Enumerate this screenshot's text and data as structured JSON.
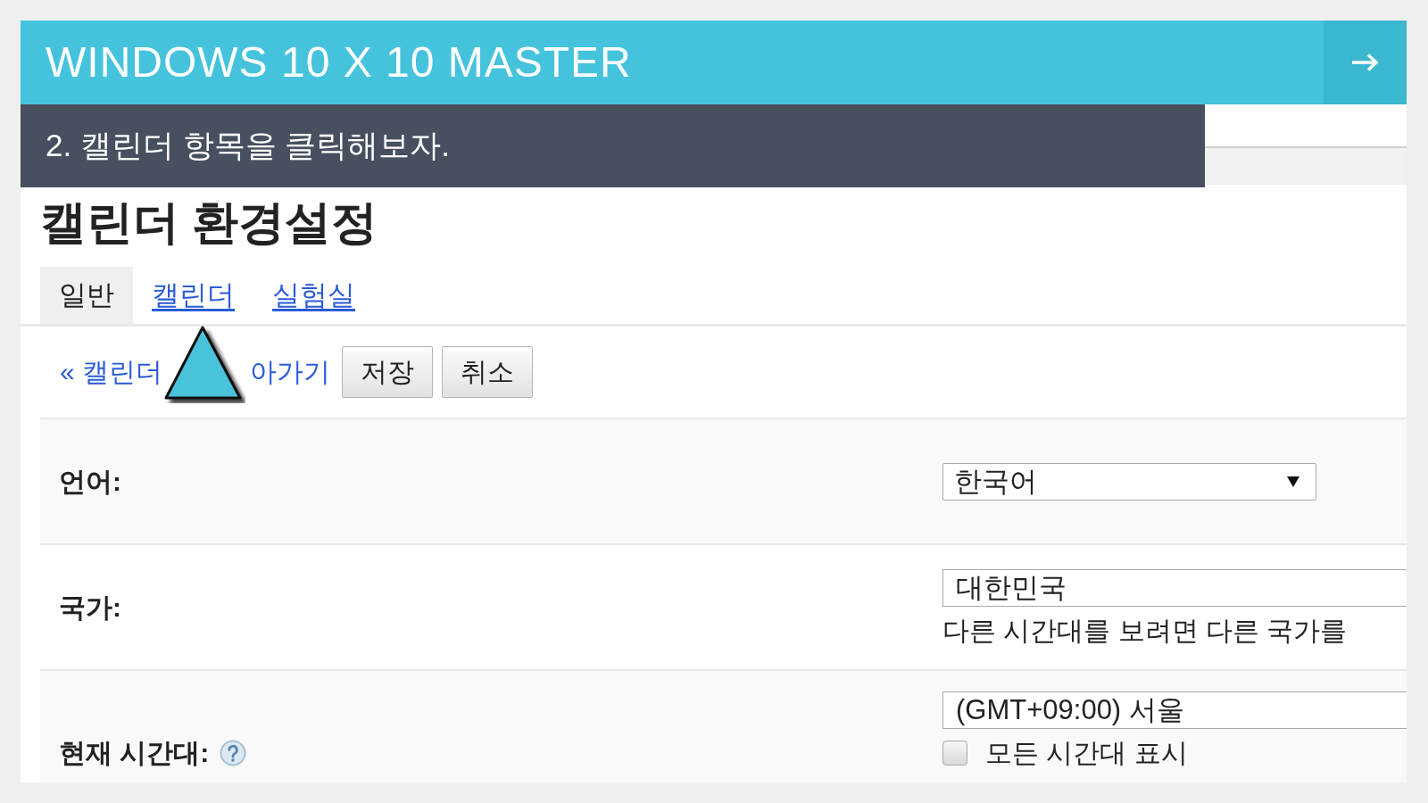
{
  "header": {
    "title": "WINDOWS 10 X 10 MASTER"
  },
  "step": {
    "caption": "2. 캘린더 항목을 클릭해보자."
  },
  "settings": {
    "title": "캘린더 환경설정",
    "tabs": [
      {
        "label": "일반",
        "selected": true
      },
      {
        "label": "캘린더",
        "selected": false
      },
      {
        "label": "실험실",
        "selected": false
      }
    ],
    "back_link": [
      "« 캘린더",
      "아가기"
    ],
    "buttons": [
      "저장",
      "취소"
    ],
    "rows": [
      {
        "kind": "dropdown",
        "label": "언어:",
        "help": false,
        "value": "한국어"
      },
      {
        "kind": "input",
        "label": "국가:",
        "help": false,
        "value": "대한민국",
        "hint": "다른 시간대를 보려면 다른 국가를"
      },
      {
        "kind": "input",
        "label": "현재 시간대:",
        "help": true,
        "value": "(GMT+09:00) 서울",
        "checkbox": {
          "label": "모든 시간대 표시",
          "checked": false
        }
      }
    ]
  }
}
